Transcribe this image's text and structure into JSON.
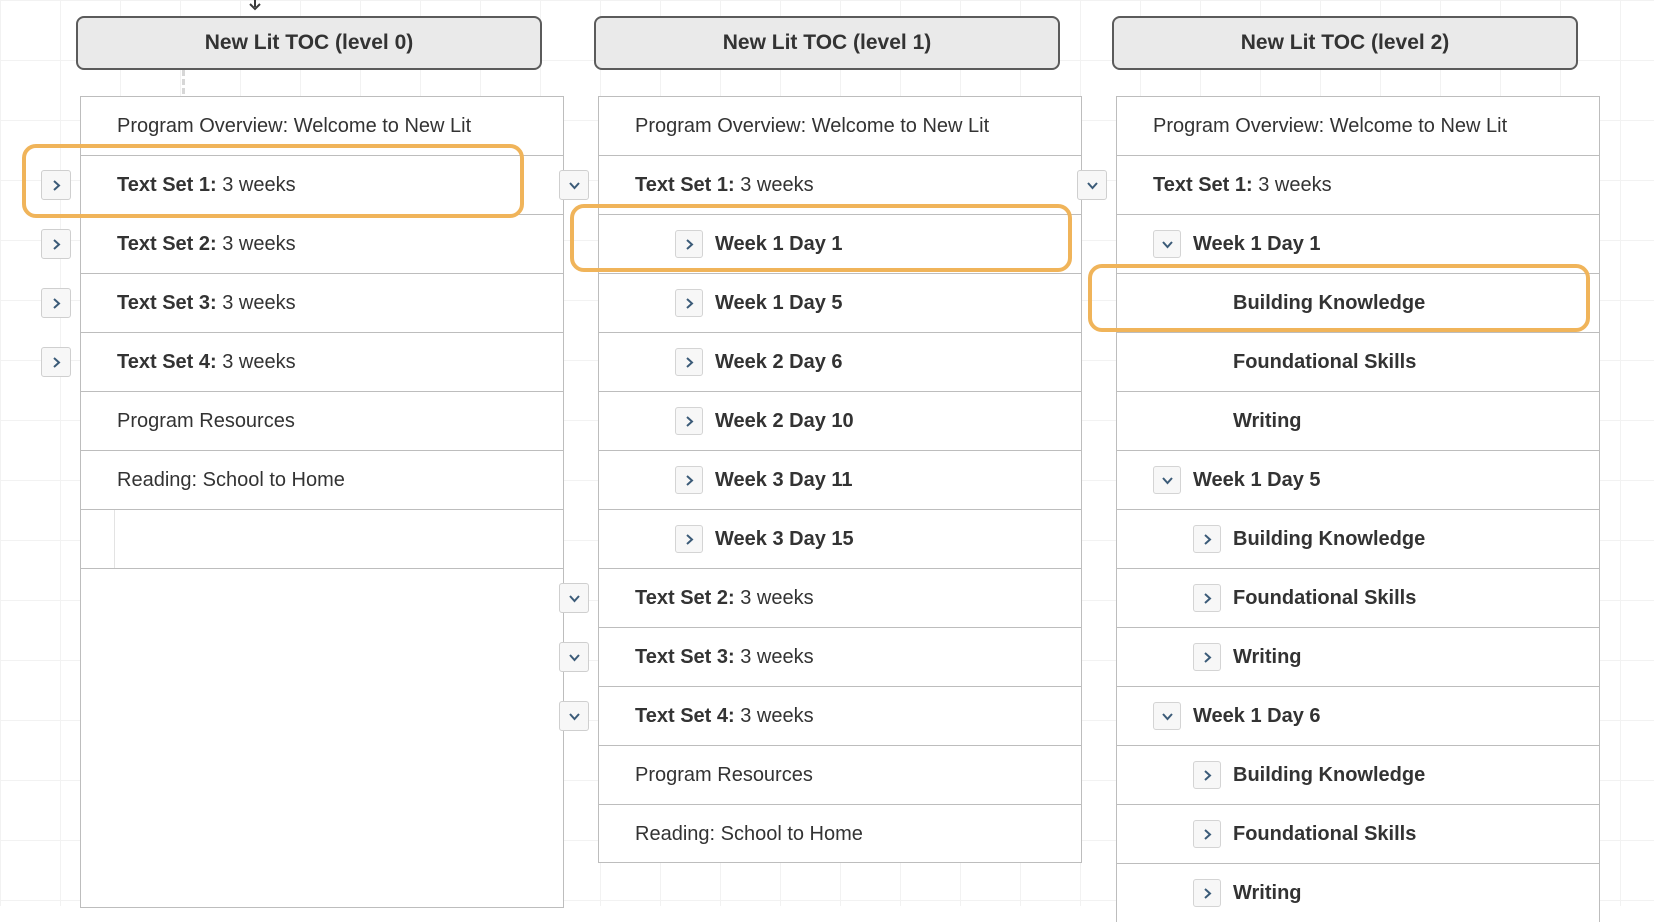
{
  "headers": {
    "level0": "New Lit TOC (level 0)",
    "level1": "New Lit TOC (level 1)",
    "level2": "New Lit TOC (level 2)"
  },
  "common": {
    "program_overview": "Program Overview: Welcome to New Lit",
    "program_resources": "Program Resources",
    "reading_school_home": "Reading: School to Home"
  },
  "textsets": {
    "ts1_label": "Text Set 1:",
    "ts1_dur": " 3 weeks",
    "ts2_label": "Text Set 2:",
    "ts2_dur": " 3 weeks",
    "ts3_label": "Text Set 3:",
    "ts3_dur": " 3 weeks",
    "ts4_label": "Text Set 4:",
    "ts4_dur": " 3 weeks",
    "ts2_label_sp": "Text Set 2: ",
    "ts2_dur_sp": " 3 weeks",
    "ts3_label_sp": "Text Set  3:",
    "ts3_dur_sp": " 3 weeks",
    "ts4_label_sp": "Text Set 4: ",
    "ts4_dur_sp": " 3 weeks"
  },
  "days": {
    "w1d1": "Week 1 Day 1",
    "w1d5": "Week 1 Day 5",
    "w2d6": "Week 2 Day 6",
    "w2d10": "Week 2 Day 10",
    "w3d11": "Week 3 Day 11",
    "w3d15": "Week 3 Day 15",
    "w1d6": "Week 1 Day 6"
  },
  "topics": {
    "building_knowledge": "Building Knowledge",
    "foundational_skills": "Foundational Skills",
    "writing": "Writing"
  }
}
